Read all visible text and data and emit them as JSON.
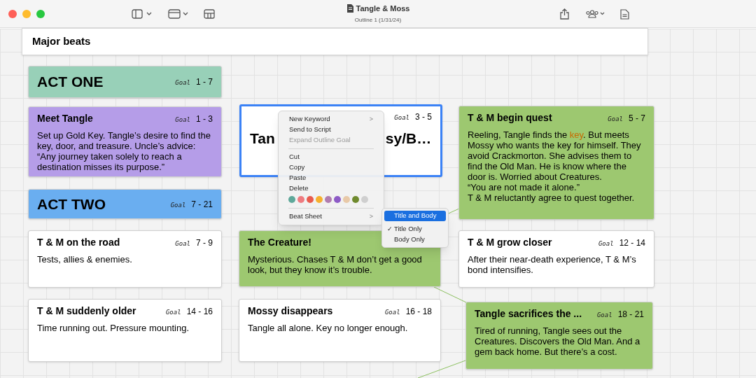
{
  "window": {
    "title": "Tangle & Moss",
    "subtitle": "Outline 1 (1/31/24)"
  },
  "header": {
    "title": "Major beats"
  },
  "cards": [
    {
      "kind": "act",
      "title": "ACT ONE",
      "goal_label": "Goal",
      "goal": "1 - 7",
      "color": "#98d0b8",
      "selected": false
    },
    {
      "kind": "beat",
      "title": "Meet Tangle",
      "goal_label": "Goal",
      "goal": "1 - 3",
      "color": "#b59de8",
      "selected": false,
      "body": [
        {
          "text": "Set up Gold Key. Tangle’s desire to find the key, door, and treasure. Uncle’s advice: “Any journey taken solely to reach a destination misses its purpose.”"
        }
      ]
    },
    {
      "kind": "title_only",
      "title_visible": [
        "Tan",
        "sy/B…"
      ],
      "goal_label": "Goal",
      "goal": "3 - 5",
      "color": "#ffffff",
      "selected": true
    },
    {
      "kind": "beat",
      "title": "T & M begin quest",
      "goal_label": "Goal",
      "goal": "5 - 7",
      "color": "#9dc870",
      "selected": false,
      "body": [
        {
          "text": "Reeling, Tangle finds the "
        },
        {
          "text": "key",
          "highlight": true
        },
        {
          "text": ". But meets Mossy who wants the key for himself. They avoid Crackmorton. She advises them to find the Old Man. He is know where the door is. Worried about Creatures.\n“You are not made it alone.”\nT & M reluctantly agree to quest together."
        }
      ]
    },
    {
      "kind": "act",
      "title": "ACT TWO",
      "goal_label": "Goal",
      "goal": "7 - 21",
      "color": "#6aaef0",
      "selected": false
    },
    {
      "kind": "beat",
      "title": "T & M on the road",
      "goal_label": "Goal",
      "goal": "7 - 9",
      "color": "#ffffff",
      "selected": false,
      "body": [
        {
          "text": "Tests, allies & enemies."
        }
      ]
    },
    {
      "kind": "beat",
      "title": "The Creature!",
      "color": "#9dc870",
      "selected": false,
      "body": [
        {
          "text": "Mysterious. Chases T & M don’t get a good look, but they know it’s trouble."
        }
      ]
    },
    {
      "kind": "beat",
      "title": "T & M grow closer",
      "goal_label": "Goal",
      "goal": "12 - 14",
      "color": "#ffffff",
      "selected": false,
      "body": [
        {
          "text": "After their near-death experience, T & M’s bond intensifies."
        }
      ]
    },
    {
      "kind": "beat",
      "title": "T & M suddenly older",
      "goal_label": "Goal",
      "goal": "14 - 16",
      "color": "#ffffff",
      "selected": false,
      "body": [
        {
          "text": "Time running out. Pressure mounting."
        }
      ]
    },
    {
      "kind": "beat",
      "title": "Mossy disappears",
      "goal_label": "Goal",
      "goal": "16 - 18",
      "color": "#ffffff",
      "selected": false,
      "body": [
        {
          "text": "Tangle all alone. Key no longer enough."
        }
      ]
    },
    {
      "kind": "beat",
      "title": "Tangle sacrifices the ...",
      "goal_label": "Goal",
      "goal": "18 - 21",
      "color": "#9dc870",
      "selected": false,
      "body": [
        {
          "text": "Tired of running, Tangle sees out the Creatures. Discovers the Old Man. And a gem back home. But there’s a cost."
        }
      ]
    }
  ],
  "context_menu": {
    "items": [
      {
        "kind": "item",
        "label": "New Keyword",
        "disabled": false,
        "submenu": true
      },
      {
        "kind": "item",
        "label": "Send to Script",
        "disabled": false,
        "submenu": false
      },
      {
        "kind": "item",
        "label": "Expand Outline Goal",
        "disabled": true,
        "submenu": false
      },
      {
        "kind": "separator"
      },
      {
        "kind": "item",
        "label": "Cut",
        "disabled": false,
        "submenu": false
      },
      {
        "kind": "item",
        "label": "Copy",
        "disabled": false,
        "submenu": false
      },
      {
        "kind": "item",
        "label": "Paste",
        "disabled": false,
        "submenu": false
      },
      {
        "kind": "item",
        "label": "Delete",
        "disabled": false,
        "submenu": false
      },
      {
        "kind": "colors",
        "colors": [
          {
            "color": "#5fa89a"
          },
          {
            "color": "#ee7b80"
          },
          {
            "color": "#e85b4e"
          },
          {
            "color": "#f6b02e"
          },
          {
            "color": "#b07db0"
          },
          {
            "color": "#8d5bc6"
          },
          {
            "color": "#e8c9a8"
          },
          {
            "color": "#6f8a2e"
          },
          {
            "color": "#cfcfcf"
          }
        ]
      },
      {
        "kind": "separator"
      },
      {
        "kind": "item",
        "label": "Beat Sheet",
        "disabled": false,
        "submenu": true
      }
    ]
  },
  "submenu": {
    "items": [
      {
        "label": "Title and Body",
        "selected": true,
        "checked": false
      },
      {
        "label": "Title Only",
        "selected": false,
        "checked": true
      },
      {
        "label": "Body Only",
        "selected": false,
        "checked": false
      }
    ]
  },
  "check_mark": "✓",
  "submenu_arrow": ">"
}
